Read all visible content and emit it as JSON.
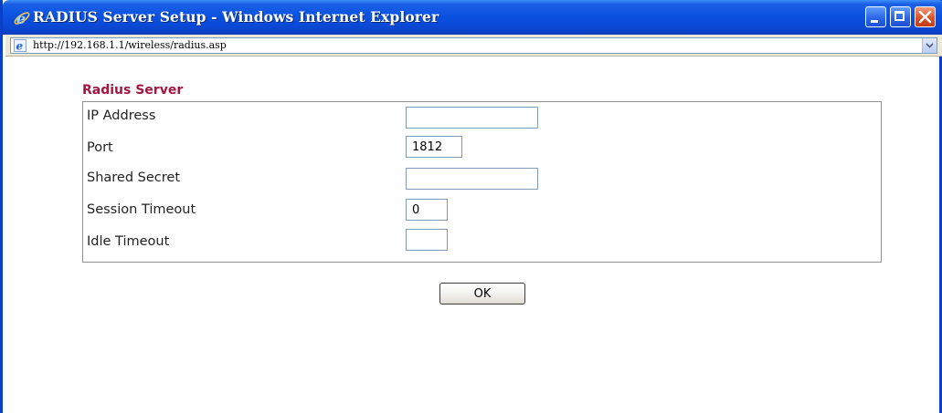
{
  "window": {
    "title": "RADIUS Server Setup - Windows Internet Explorer",
    "icon": "internet-explorer-icon",
    "accent_color": "#0a49d6",
    "close_color": "#d9542a"
  },
  "address_bar": {
    "url": "http://192.168.1.1/wireless/radius.asp",
    "icon": "ie-page-icon"
  },
  "form": {
    "section_title": "Radius Server",
    "section_title_color": "#a3163f",
    "fields": [
      {
        "label": "IP Address",
        "value": ""
      },
      {
        "label": "Port",
        "value": "1812"
      },
      {
        "label": "Shared Secret",
        "value": ""
      },
      {
        "label": "Session Timeout",
        "value": "0"
      },
      {
        "label": "Idle Timeout",
        "value": ""
      }
    ],
    "ok_label": "OK"
  }
}
